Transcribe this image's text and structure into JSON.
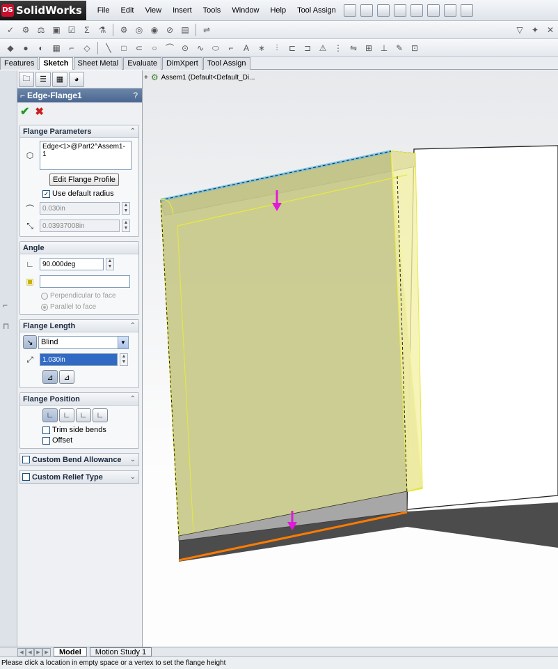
{
  "app": {
    "brand": "SolidWorks",
    "logo_letters": "DS"
  },
  "menu": [
    "File",
    "Edit",
    "View",
    "Insert",
    "Tools",
    "Window",
    "Help",
    "Tool Assign"
  ],
  "command_tabs": [
    "Features",
    "Sketch",
    "Sheet Metal",
    "Evaluate",
    "DimXpert",
    "Tool Assign"
  ],
  "tree": {
    "root": "Assem1  (Default<Default_Di..."
  },
  "property_manager": {
    "title": "Edge-Flange1",
    "help": "?",
    "flange_parameters": {
      "header": "Flange Parameters",
      "edge_list": "Edge<1>@Part2^Assem1-1",
      "edit_profile_label": "Edit Flange Profile",
      "use_default_radius_label": "Use default radius",
      "use_default_radius_checked": true,
      "radius_value": "0.030in",
      "gap_value": "0.03937008in"
    },
    "angle": {
      "header": "Angle",
      "value": "90.000deg",
      "face_value": "",
      "perpendicular_label": "Perpendicular to face",
      "parallel_label": "Parallel to face"
    },
    "flange_length": {
      "header": "Flange Length",
      "end_condition": "Blind",
      "length_value": "1.030in"
    },
    "flange_position": {
      "header": "Flange Position",
      "trim_side_bends_label": "Trim side bends",
      "offset_label": "Offset"
    },
    "custom_bend_allowance": "Custom Bend Allowance",
    "custom_relief_type": "Custom Relief Type"
  },
  "bottom_tabs": [
    "Model",
    "Motion Study 1"
  ],
  "status": "Please click a location in empty space or a vertex to set the flange height",
  "colors": {
    "flange_fill": "#c8c98a",
    "edge_highlight": "#ff7b00",
    "arrow": "#e01ad8",
    "selected_edge": "#5fb8e8"
  }
}
